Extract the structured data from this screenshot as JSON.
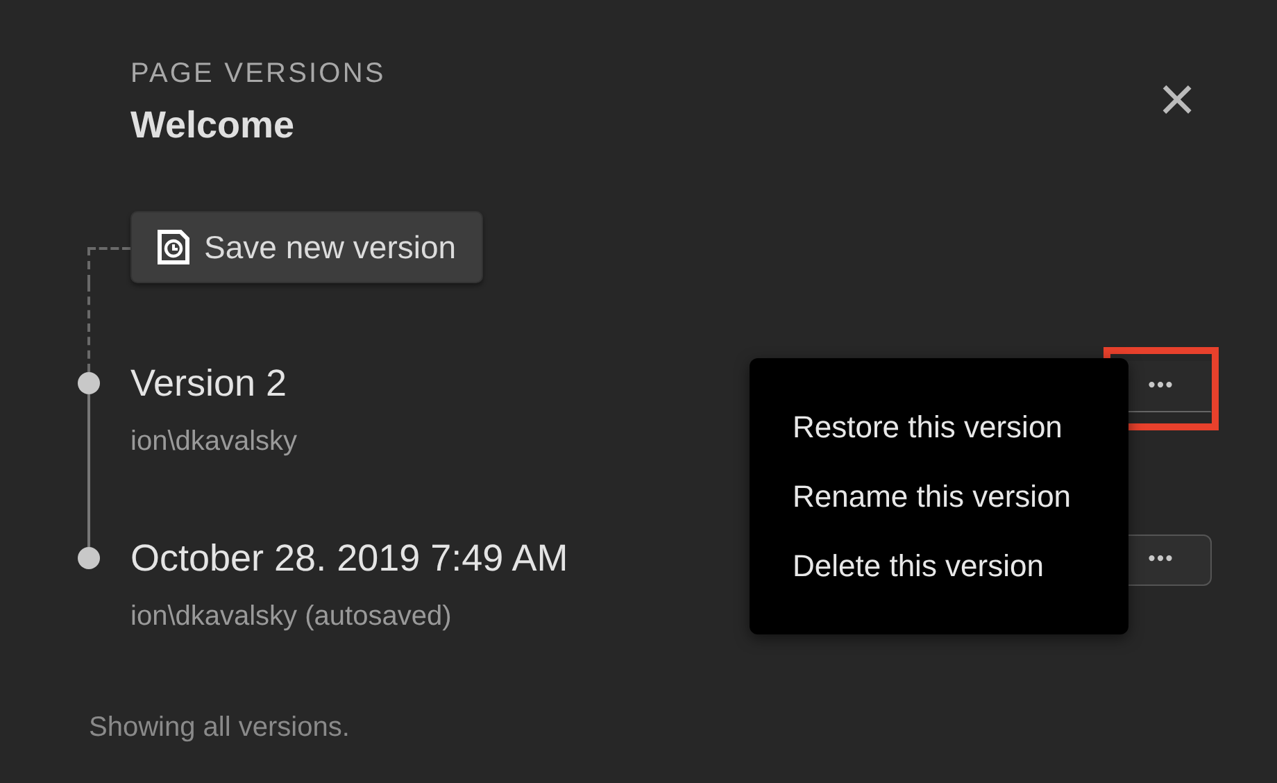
{
  "header": {
    "eyebrow": "PAGE VERSIONS",
    "title": "Welcome",
    "close_label": "×"
  },
  "save_button": {
    "label": "Save new version"
  },
  "versions": [
    {
      "title": "Version 2",
      "author": "ion\\dkavalsky",
      "more_label": "•••",
      "menu_open": true,
      "highlighted": true
    },
    {
      "title": "October 28. 2019 7:49 AM",
      "author": "ion\\dkavalsky (autosaved)",
      "more_label": "•••",
      "menu_open": false,
      "highlighted": false
    }
  ],
  "menu": {
    "items": [
      "Restore this version",
      "Rename this version",
      "Delete this version"
    ]
  },
  "footer": "Showing all versions."
}
